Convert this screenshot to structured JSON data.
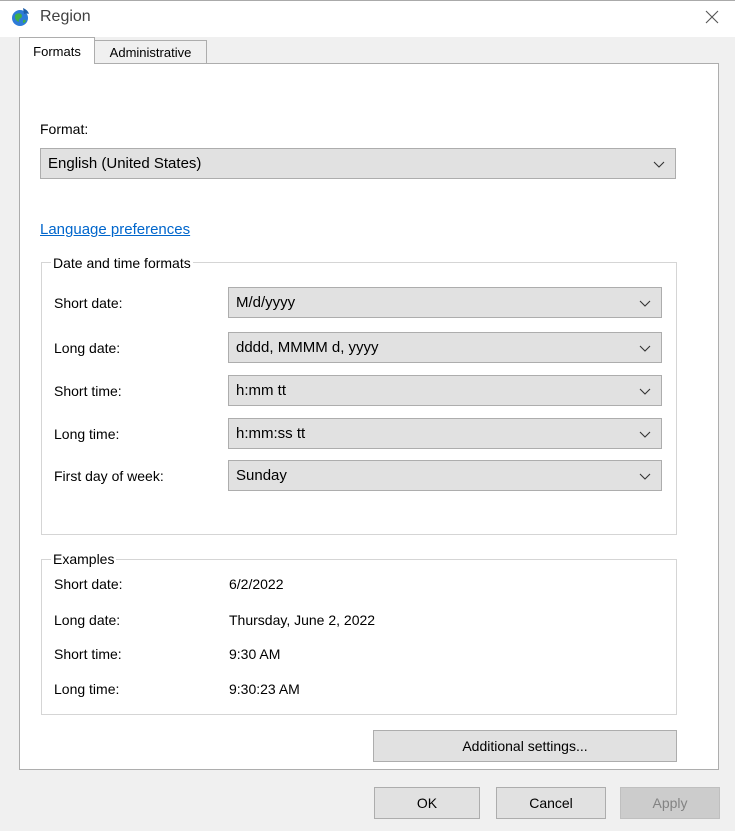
{
  "window": {
    "title": "Region",
    "close_icon": "close-icon",
    "app_icon": "globe-icon"
  },
  "tabs": [
    {
      "label": "Formats",
      "selected": true
    },
    {
      "label": "Administrative",
      "selected": false
    }
  ],
  "format": {
    "label": "Format:",
    "value": "English (United States)"
  },
  "language_link": "Language preferences",
  "date_time_formats": {
    "title": "Date and time formats",
    "rows": [
      {
        "label": "Short date:",
        "value": "M/d/yyyy"
      },
      {
        "label": "Long date:",
        "value": "dddd, MMMM d, yyyy"
      },
      {
        "label": "Short time:",
        "value": "h:mm tt"
      },
      {
        "label": "Long time:",
        "value": "h:mm:ss tt"
      },
      {
        "label": "First day of week:",
        "value": "Sunday"
      }
    ]
  },
  "examples": {
    "title": "Examples",
    "rows": [
      {
        "label": "Short date:",
        "value": "6/2/2022"
      },
      {
        "label": "Long date:",
        "value": "Thursday, June 2, 2022"
      },
      {
        "label": "Short time:",
        "value": "9:30 AM"
      },
      {
        "label": "Long time:",
        "value": "9:30:23 AM"
      }
    ]
  },
  "buttons": {
    "additional": "Additional settings...",
    "ok": "OK",
    "cancel": "Cancel",
    "apply": "Apply"
  },
  "colors": {
    "link": "#0066cc",
    "combo_bg": "#e1e1e1",
    "dialog_bg": "#f0f0f0"
  }
}
